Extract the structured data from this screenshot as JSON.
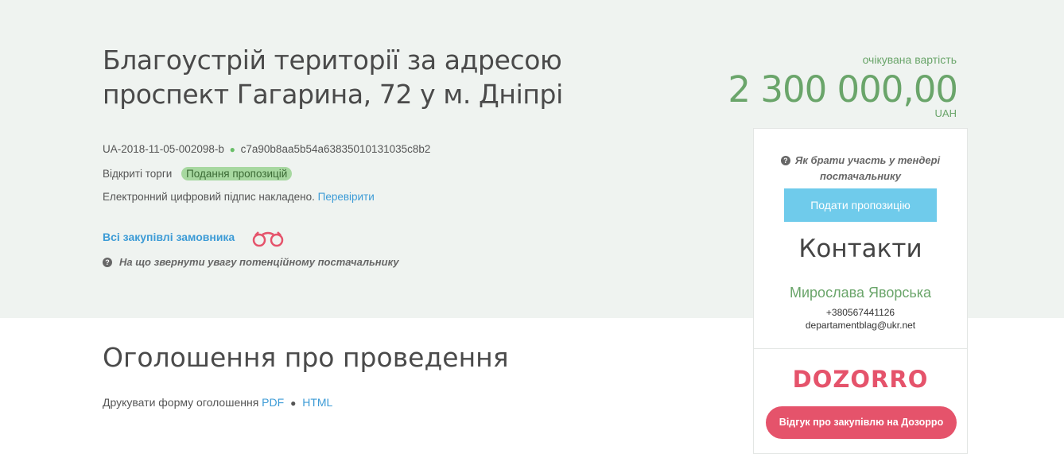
{
  "tender": {
    "title": "Благоустрій території за адресою проспект Гагарина, 72 у м. Дніпрі",
    "id": "UA-2018-11-05-002098-b",
    "hash": "c7a90b8aa5b54a63835010131035c8b2",
    "procedure": "Відкриті торги",
    "status": "Подання пропозицій",
    "signature_text": "Електронний цифровий підпис накладено.",
    "signature_link": "Перевірити",
    "all_purchases_link": "Всі закупівлі замовника",
    "supplier_note": "На що звернути увагу потенційному постачальнику"
  },
  "expected": {
    "label": "очікувана вартість",
    "value": "2 300 000,00",
    "currency": "UAH"
  },
  "sidebar": {
    "how_to_participate": "Як брати участь у тендері постачальнику",
    "submit_button": "Подати пропозицію",
    "contacts_title": "Контакти",
    "contact_name": "Мирослава Яворська",
    "contact_phone": "+380567441126",
    "contact_email": "departamentblag@ukr.net",
    "dozorro_logo": "DOZORRO",
    "review_button": "Відгук про закупівлю на Дозорро"
  },
  "announcement": {
    "title": "Оголошення про проведення",
    "print_label": "Друкувати форму оголошення",
    "pdf_link": "PDF",
    "html_link": "HTML"
  },
  "colors": {
    "hero_bg": "#eff3f0",
    "accent_green": "#6aa56a",
    "link_blue": "#3c9bd6",
    "submit_blue": "#6fcbeb",
    "dozorro_red": "#e5536b",
    "badge_green": "#a7d8a0"
  },
  "icons": {
    "question": "question-circle-icon",
    "binoculars": "binoculars-icon",
    "separator": "dot-separator-icon"
  }
}
